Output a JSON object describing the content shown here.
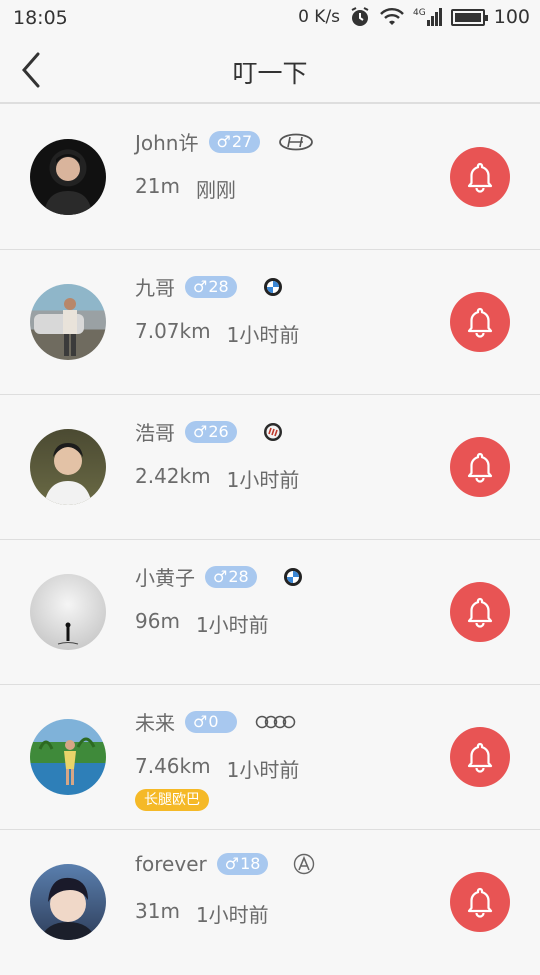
{
  "status_bar": {
    "time": "18:05",
    "net_speed": "0 K/s",
    "signal_label": "4G",
    "battery": "100"
  },
  "header": {
    "title": "叮一下"
  },
  "colors": {
    "accent_red": "#e85454",
    "age_badge_blue": "#a8c8ef",
    "tag_yellow": "#f5b927"
  },
  "users": [
    {
      "name": "John许",
      "gender_symbol": "♂",
      "age": "27",
      "car_icon": "hyundai-logo-icon",
      "distance": "21m",
      "time": "刚刚",
      "tag": ""
    },
    {
      "name": "九哥",
      "gender_symbol": "♂",
      "age": "28",
      "car_icon": "bmw-logo-icon",
      "distance": "7.07km",
      "time": "1小时前",
      "tag": ""
    },
    {
      "name": "浩哥",
      "gender_symbol": "♂",
      "age": "26",
      "car_icon": "buick-logo-icon",
      "distance": "2.42km",
      "time": "1小时前",
      "tag": ""
    },
    {
      "name": "小黄子",
      "gender_symbol": "♂",
      "age": "28",
      "car_icon": "bmw-logo-icon",
      "distance": "96m",
      "time": "1小时前",
      "tag": ""
    },
    {
      "name": "未来",
      "gender_symbol": "♂",
      "age": "0",
      "car_icon": "audi-logo-icon",
      "distance": "7.46km",
      "time": "1小时前",
      "tag": "长腿欧巴"
    },
    {
      "name": "forever",
      "gender_symbol": "♂",
      "age": "18",
      "car_icon": "acura-logo-icon",
      "distance": "31m",
      "time": "1小时前",
      "tag": ""
    }
  ]
}
